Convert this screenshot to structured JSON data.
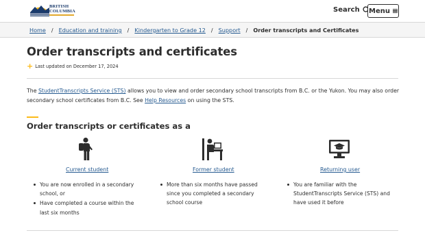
{
  "header": {
    "logo_line1": "BRITISH",
    "logo_line2": "COLUMBIA",
    "search_label": "Search",
    "menu_label": "Menu"
  },
  "breadcrumb": {
    "items": [
      "Home",
      "Education and training",
      "Kindergarten to Grade 12",
      "Support"
    ],
    "separator": "/",
    "current": "Order transcripts and Certificates"
  },
  "page": {
    "title": "Order transcripts and certificates",
    "updated": "Last updated on December 17, 2024"
  },
  "intro": {
    "text_a": "The ",
    "link_sts": "StudentTranscripts Service (STS)",
    "text_b": " allows you to view and order secondary school transcripts from B.C. or the Yukon. You may also order secondary school certificates from B.C. See ",
    "link_help": "Help Resources",
    "text_c": " on using the STS."
  },
  "section": {
    "heading": "Order transcripts or certificates as a"
  },
  "options": [
    {
      "icon": "student-backpack-icon",
      "title": "Current student",
      "bullets": [
        "You are now enrolled in a secondary school, or",
        "Have completed a course within the last six months"
      ]
    },
    {
      "icon": "desk-person-icon",
      "title": "Former student",
      "bullets": [
        "More than six months have passed since you completed a secondary school course"
      ]
    },
    {
      "icon": "computer-graduation-cap-icon",
      "title": "Returning user",
      "bullets": [
        "You are familiar with the StudentTranscripts Service (STS) and have used it before"
      ]
    }
  ],
  "colors": {
    "link": "#255a90",
    "accent": "#fcba19",
    "text": "#2d2d2d",
    "brand_navy": "#1a3a6b"
  }
}
